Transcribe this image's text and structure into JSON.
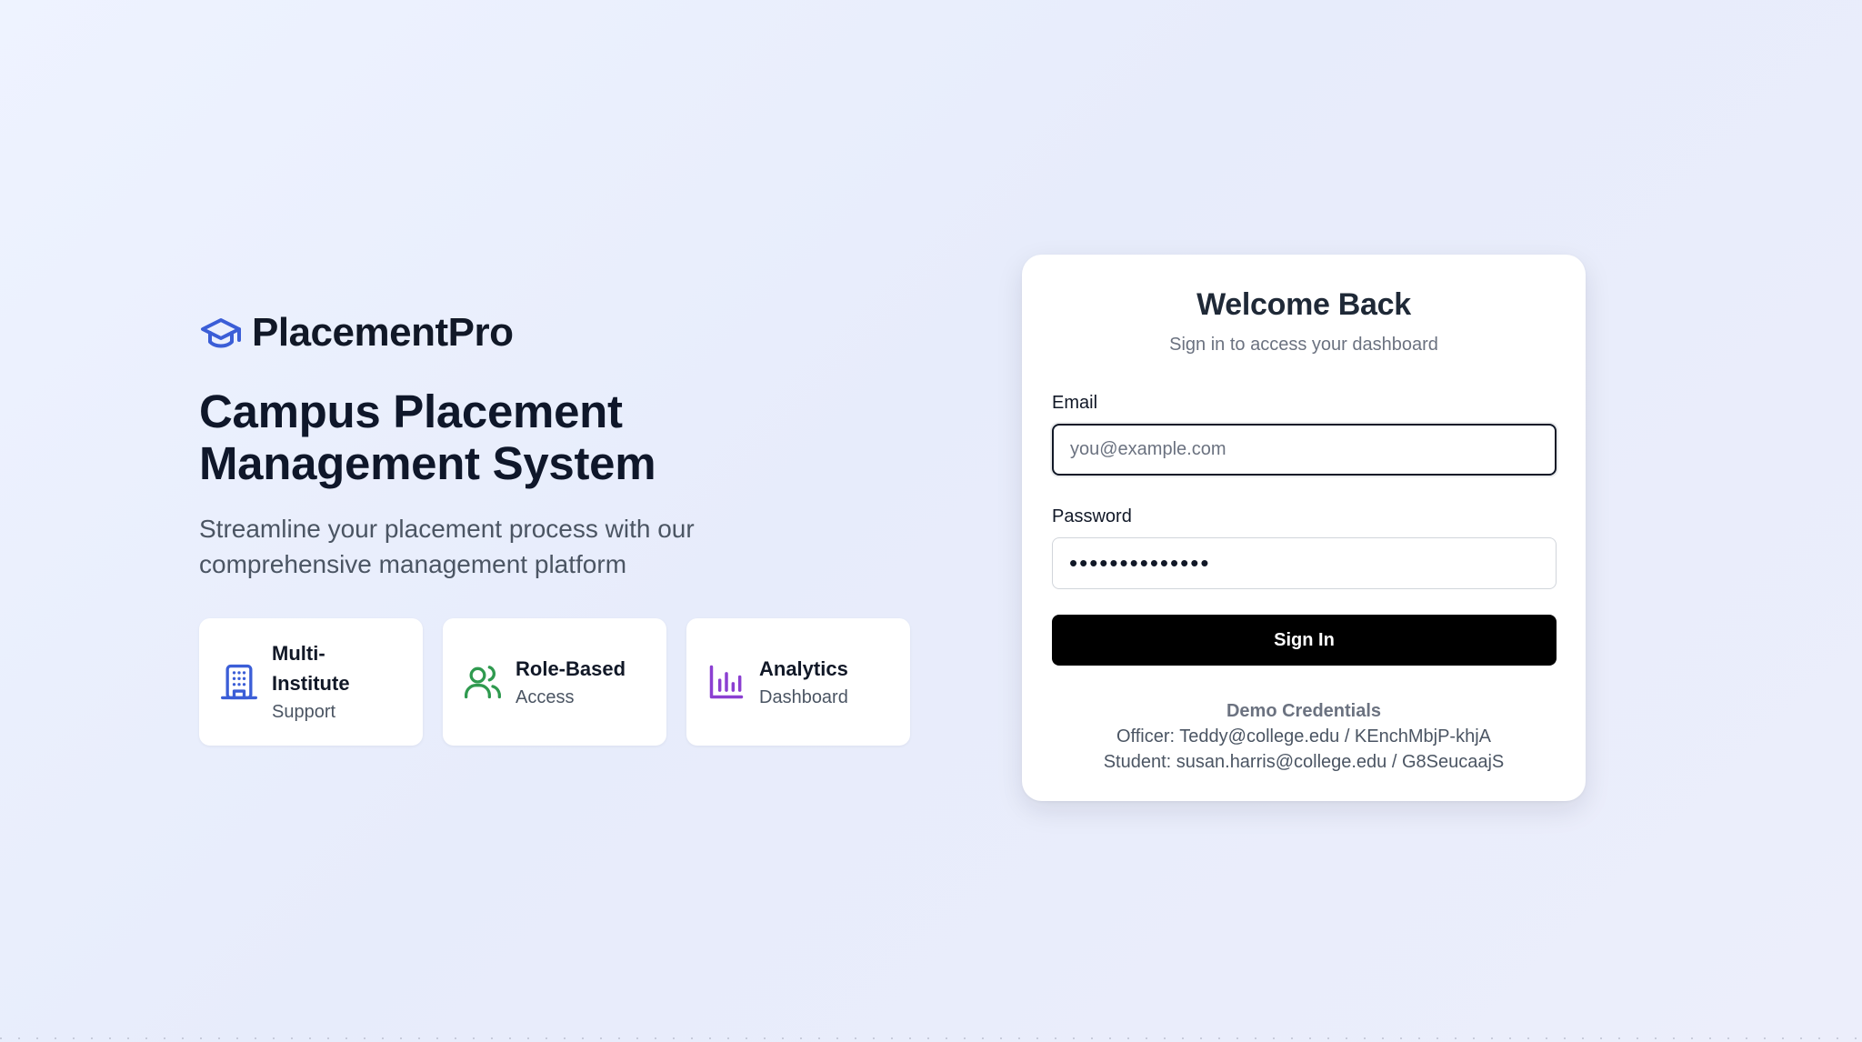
{
  "brand": {
    "name": "PlacementPro",
    "icon": "graduation-cap-icon"
  },
  "hero": {
    "headline": "Campus Placement Management System",
    "subhead": "Streamline your placement process with our comprehensive management platform"
  },
  "features": [
    {
      "title": "Multi-Institute",
      "subtitle": "Support",
      "icon": "building-icon",
      "color": "#3b5ed7"
    },
    {
      "title": "Role-Based",
      "subtitle": "Access",
      "icon": "users-icon",
      "color": "#2f9a4f"
    },
    {
      "title": "Analytics",
      "subtitle": "Dashboard",
      "icon": "bar-chart-icon",
      "color": "#8b3fd1"
    }
  ],
  "login": {
    "title": "Welcome Back",
    "subtitle": "Sign in to access your dashboard",
    "email_label": "Email",
    "email_placeholder": "you@example.com",
    "email_value": "",
    "password_label": "Password",
    "password_value": "••••••••••••••",
    "submit_label": "Sign In"
  },
  "demo": {
    "title": "Demo Credentials",
    "officer": "Officer: Teddy@college.edu / KEnchMbjP-khjA",
    "student": "Student: susan.harris@college.edu / G8SeucaajS"
  },
  "colors": {
    "brand_icon": "#3b5ed7",
    "button_bg": "#000000",
    "button_text": "#ffffff",
    "text_primary": "#111827",
    "text_muted": "#6b7280"
  }
}
